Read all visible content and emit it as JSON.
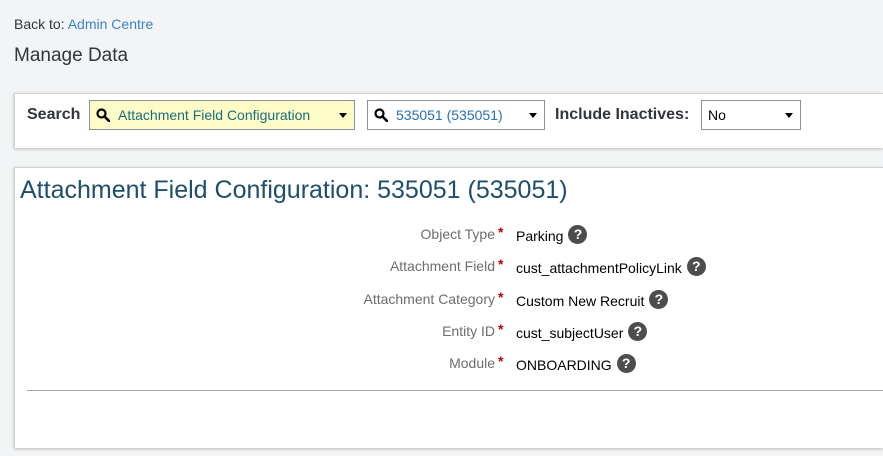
{
  "header": {
    "back_prefix": "Back to:",
    "back_link": "Admin Centre",
    "title": "Manage Data"
  },
  "search": {
    "label": "Search",
    "object_value": "Attachment Field Configuration",
    "record_value": "535051 (535051)",
    "include_inactives_label": "Include Inactives:",
    "include_inactives_value": "No"
  },
  "detail": {
    "title": "Attachment Field Configuration: 535051 (535051)",
    "fields": [
      {
        "label": "Object Type",
        "value": "Parking"
      },
      {
        "label": "Attachment Field",
        "value": "cust_attachmentPolicyLink"
      },
      {
        "label": "Attachment Category",
        "value": "Custom New Recruit"
      },
      {
        "label": "Entity ID",
        "value": "cust_subjectUser"
      },
      {
        "label": "Module",
        "value": "ONBOARDING"
      }
    ],
    "required_marker": "*",
    "help_glyph": "?"
  },
  "colors": {
    "link": "#3a84c4",
    "title": "#1d4e6b",
    "highlight": "#fdfbc8",
    "required": "#bb0000"
  },
  "icons": {
    "search": "magnifier-icon",
    "dropdown": "caret-down-icon",
    "help": "question-circle-icon"
  }
}
